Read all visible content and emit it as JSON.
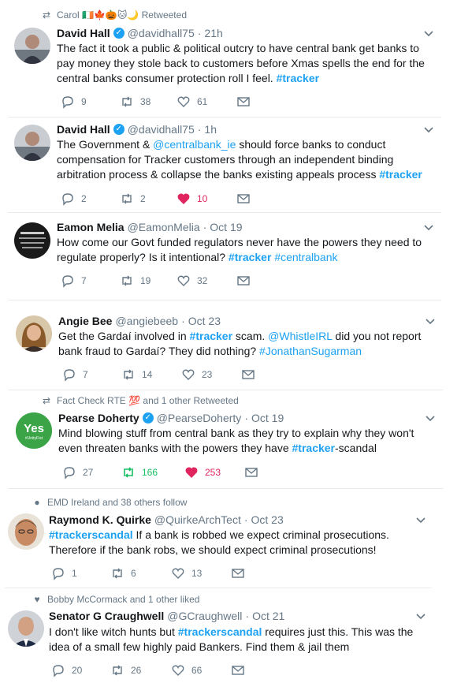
{
  "tweets": [
    {
      "context": "Carol 🇮🇪🍁🎃🐱🌙 Retweeted",
      "context_icon": "retweet-icon",
      "name": "David Hall",
      "verified": true,
      "handle": "@davidhall75",
      "time": "21h",
      "text_parts": [
        {
          "t": "The fact it took a public & political outcry to have central bank get banks to pay money they stole back to customers before Xmas spells the end for the central banks consumer protection roll I feel. "
        },
        {
          "t": "#tracker",
          "cls": "tag"
        }
      ],
      "reply": "9",
      "retweet": "38",
      "like": "61",
      "liked": false,
      "retweeted": false
    },
    {
      "context": "",
      "name": "David Hall",
      "verified": true,
      "handle": "@davidhall75",
      "time": "1h",
      "text_parts": [
        {
          "t": "The Government & "
        },
        {
          "t": "@centralbank_ie",
          "cls": "link"
        },
        {
          "t": " should force banks to conduct compensation for Tracker customers through an independent binding arbitration process & collapse the banks existing appeals process "
        },
        {
          "t": "#tracker",
          "cls": "tag"
        }
      ],
      "reply": "2",
      "retweet": "2",
      "like": "10",
      "liked": true,
      "retweeted": false
    },
    {
      "context": "",
      "name": "Eamon Melia",
      "verified": false,
      "handle": "@EamonMelia",
      "time": "Oct 19",
      "text_parts": [
        {
          "t": "How come our Govt funded regulators never have the powers they need to regulate properly?  Is it intentional? "
        },
        {
          "t": "#tracker",
          "cls": "tag"
        },
        {
          "t": " "
        },
        {
          "t": "#centralbank",
          "cls": "link"
        }
      ],
      "reply": "7",
      "retweet": "19",
      "like": "32",
      "liked": false,
      "retweeted": false
    },
    {
      "context": "",
      "name": "Angie Bee",
      "verified": false,
      "handle": "@angiebeeb",
      "time": "Oct 23",
      "text_parts": [
        {
          "t": "Get the Gardaí involved in "
        },
        {
          "t": "#tracker",
          "cls": "tag"
        },
        {
          "t": " scam. "
        },
        {
          "t": "@WhistleIRL",
          "cls": "link"
        },
        {
          "t": " did you not report bank fraud to Gardaí? They did nothing? "
        },
        {
          "t": "#JonathanSugarman",
          "cls": "link"
        }
      ],
      "reply": "7",
      "retweet": "14",
      "like": "23",
      "liked": false,
      "retweeted": false
    },
    {
      "context": "Fact Check RTE 💯 and 1 other Retweeted",
      "context_icon": "retweet-icon",
      "name": "Pearse Doherty",
      "verified": true,
      "handle": "@PearseDoherty",
      "time": "Oct 19",
      "text_parts": [
        {
          "t": "Mind blowing stuff from central bank as they try to explain why they won't even threaten banks with the powers they have "
        },
        {
          "t": "#tracker",
          "cls": "tag"
        },
        {
          "t": "-scandal"
        }
      ],
      "reply": "27",
      "retweet": "166",
      "like": "253",
      "liked": true,
      "retweeted": true,
      "avatar_text": "Yes",
      "avatar_subtext": "#UnityFist"
    },
    {
      "context": "EMD Ireland and 38 others follow",
      "context_icon": "person-icon",
      "name": "Raymond K. Quirke",
      "verified": false,
      "handle": "@QuirkeArchTect",
      "time": "Oct 23",
      "text_parts": [
        {
          "t": "#trackerscandal",
          "cls": "tag"
        },
        {
          "t": " If a bank is robbed we expect criminal prosecutions. Therefore if the bank robs, we should expect criminal prosecutions!"
        }
      ],
      "reply": "1",
      "retweet": "6",
      "like": "13",
      "liked": false,
      "retweeted": false
    },
    {
      "context": "Bobby McCormack and 1 other liked",
      "context_icon": "heart-small-icon",
      "name": "Senator G Craughwell",
      "verified": false,
      "handle": "@GCraughwell",
      "time": "Oct 21",
      "text_parts": [
        {
          "t": "I don't like witch hunts but "
        },
        {
          "t": "#trackerscandal",
          "cls": "tag"
        },
        {
          "t": " requires just this. This was the idea of a small few highly paid Bankers. Find them & jail them"
        }
      ],
      "reply": "20",
      "retweet": "26",
      "like": "66",
      "liked": false,
      "retweeted": false
    }
  ],
  "labels": {
    "separator": "·",
    "verified_mark": "✓"
  },
  "colors": {
    "accent": "#1da1f2",
    "like_active": "#e0245e",
    "retweet_active": "#17bf63",
    "muted": "#657786"
  }
}
